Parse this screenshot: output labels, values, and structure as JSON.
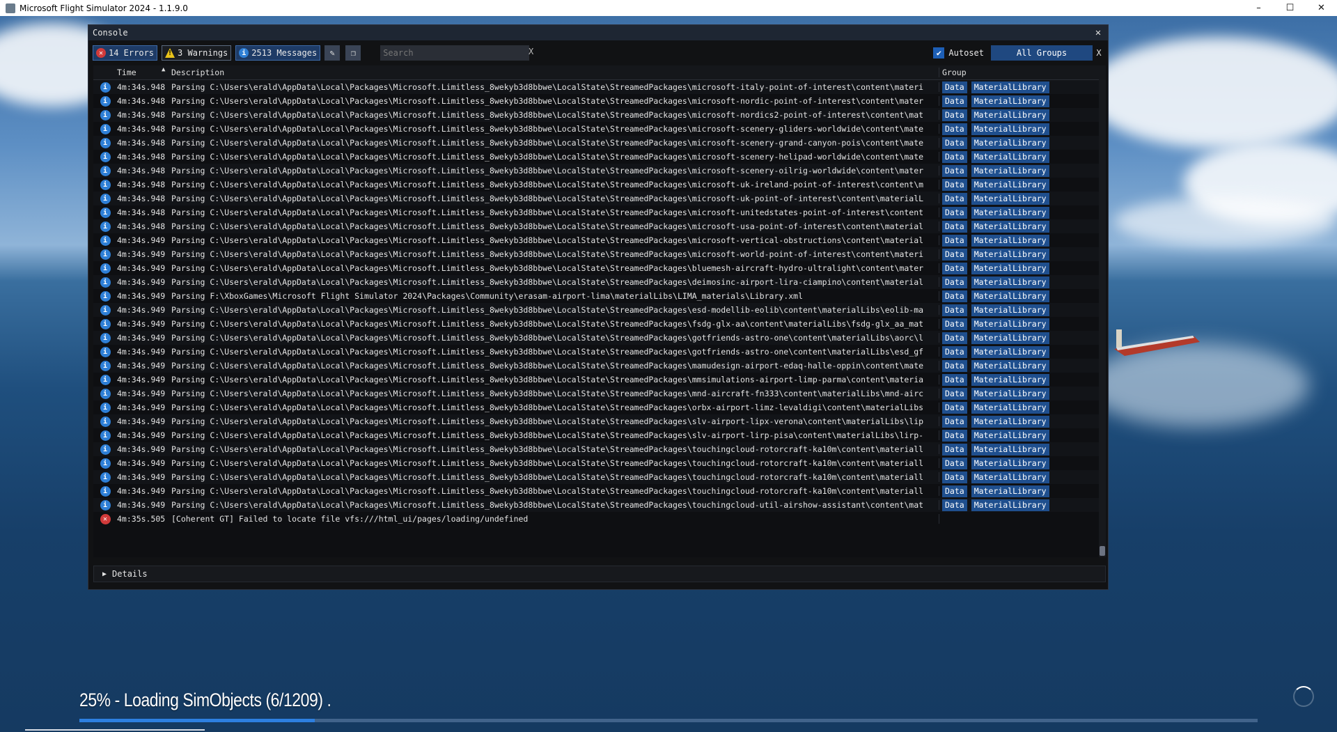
{
  "window": {
    "title": "Microsoft Flight Simulator 2024 - 1.1.9.0",
    "minimize": "–",
    "maximize": "☐",
    "close": "✕"
  },
  "console": {
    "title": "Console",
    "close": "✕",
    "filters": {
      "errors": "14 Errors",
      "warnings": "3 Warnings",
      "messages": "2513 Messages"
    },
    "search": {
      "placeholder": "Search",
      "clear": "X"
    },
    "autoset": "Autoset",
    "groups": "All Groups",
    "groups_clear": "X",
    "columns": {
      "time": "Time",
      "description": "Description",
      "group": "Group"
    },
    "rows": [
      {
        "type": "info",
        "time": "4m:34s.948",
        "desc": "Parsing C:\\Users\\erald\\AppData\\Local\\Packages\\Microsoft.Limitless_8wekyb3d8bbwe\\LocalState\\StreamedPackages\\microsoft-italy-point-of-interest\\content\\materi",
        "g1": "Data",
        "g2": "MaterialLibrary"
      },
      {
        "type": "info",
        "time": "4m:34s.948",
        "desc": "Parsing C:\\Users\\erald\\AppData\\Local\\Packages\\Microsoft.Limitless_8wekyb3d8bbwe\\LocalState\\StreamedPackages\\microsoft-nordic-point-of-interest\\content\\mater",
        "g1": "Data",
        "g2": "MaterialLibrary"
      },
      {
        "type": "info",
        "time": "4m:34s.948",
        "desc": "Parsing C:\\Users\\erald\\AppData\\Local\\Packages\\Microsoft.Limitless_8wekyb3d8bbwe\\LocalState\\StreamedPackages\\microsoft-nordics2-point-of-interest\\content\\mat",
        "g1": "Data",
        "g2": "MaterialLibrary"
      },
      {
        "type": "info",
        "time": "4m:34s.948",
        "desc": "Parsing C:\\Users\\erald\\AppData\\Local\\Packages\\Microsoft.Limitless_8wekyb3d8bbwe\\LocalState\\StreamedPackages\\microsoft-scenery-gliders-worldwide\\content\\mate",
        "g1": "Data",
        "g2": "MaterialLibrary"
      },
      {
        "type": "info",
        "time": "4m:34s.948",
        "desc": "Parsing C:\\Users\\erald\\AppData\\Local\\Packages\\Microsoft.Limitless_8wekyb3d8bbwe\\LocalState\\StreamedPackages\\microsoft-scenery-grand-canyon-pois\\content\\mate",
        "g1": "Data",
        "g2": "MaterialLibrary"
      },
      {
        "type": "info",
        "time": "4m:34s.948",
        "desc": "Parsing C:\\Users\\erald\\AppData\\Local\\Packages\\Microsoft.Limitless_8wekyb3d8bbwe\\LocalState\\StreamedPackages\\microsoft-scenery-helipad-worldwide\\content\\mate",
        "g1": "Data",
        "g2": "MaterialLibrary"
      },
      {
        "type": "info",
        "time": "4m:34s.948",
        "desc": "Parsing C:\\Users\\erald\\AppData\\Local\\Packages\\Microsoft.Limitless_8wekyb3d8bbwe\\LocalState\\StreamedPackages\\microsoft-scenery-oilrig-worldwide\\content\\mater",
        "g1": "Data",
        "g2": "MaterialLibrary"
      },
      {
        "type": "info",
        "time": "4m:34s.948",
        "desc": "Parsing C:\\Users\\erald\\AppData\\Local\\Packages\\Microsoft.Limitless_8wekyb3d8bbwe\\LocalState\\StreamedPackages\\microsoft-uk-ireland-point-of-interest\\content\\m",
        "g1": "Data",
        "g2": "MaterialLibrary"
      },
      {
        "type": "info",
        "time": "4m:34s.948",
        "desc": "Parsing C:\\Users\\erald\\AppData\\Local\\Packages\\Microsoft.Limitless_8wekyb3d8bbwe\\LocalState\\StreamedPackages\\microsoft-uk-point-of-interest\\content\\materialL",
        "g1": "Data",
        "g2": "MaterialLibrary"
      },
      {
        "type": "info",
        "time": "4m:34s.948",
        "desc": "Parsing C:\\Users\\erald\\AppData\\Local\\Packages\\Microsoft.Limitless_8wekyb3d8bbwe\\LocalState\\StreamedPackages\\microsoft-unitedstates-point-of-interest\\content",
        "g1": "Data",
        "g2": "MaterialLibrary"
      },
      {
        "type": "info",
        "time": "4m:34s.948",
        "desc": "Parsing C:\\Users\\erald\\AppData\\Local\\Packages\\Microsoft.Limitless_8wekyb3d8bbwe\\LocalState\\StreamedPackages\\microsoft-usa-point-of-interest\\content\\material",
        "g1": "Data",
        "g2": "MaterialLibrary"
      },
      {
        "type": "info",
        "time": "4m:34s.949",
        "desc": "Parsing C:\\Users\\erald\\AppData\\Local\\Packages\\Microsoft.Limitless_8wekyb3d8bbwe\\LocalState\\StreamedPackages\\microsoft-vertical-obstructions\\content\\material",
        "g1": "Data",
        "g2": "MaterialLibrary"
      },
      {
        "type": "info",
        "time": "4m:34s.949",
        "desc": "Parsing C:\\Users\\erald\\AppData\\Local\\Packages\\Microsoft.Limitless_8wekyb3d8bbwe\\LocalState\\StreamedPackages\\microsoft-world-point-of-interest\\content\\materi",
        "g1": "Data",
        "g2": "MaterialLibrary"
      },
      {
        "type": "info",
        "time": "4m:34s.949",
        "desc": "Parsing C:\\Users\\erald\\AppData\\Local\\Packages\\Microsoft.Limitless_8wekyb3d8bbwe\\LocalState\\StreamedPackages\\bluemesh-aircraft-hydro-ultralight\\content\\mater",
        "g1": "Data",
        "g2": "MaterialLibrary"
      },
      {
        "type": "info",
        "time": "4m:34s.949",
        "desc": "Parsing C:\\Users\\erald\\AppData\\Local\\Packages\\Microsoft.Limitless_8wekyb3d8bbwe\\LocalState\\StreamedPackages\\deimosinc-airport-lira-ciampino\\content\\material",
        "g1": "Data",
        "g2": "MaterialLibrary"
      },
      {
        "type": "info",
        "time": "4m:34s.949",
        "desc": "Parsing F:\\XboxGames\\Microsoft Flight Simulator 2024\\Packages\\Community\\erasam-airport-lima\\materialLibs\\LIMA_materials\\Library.xml",
        "g1": "Data",
        "g2": "MaterialLibrary"
      },
      {
        "type": "info",
        "time": "4m:34s.949",
        "desc": "Parsing C:\\Users\\erald\\AppData\\Local\\Packages\\Microsoft.Limitless_8wekyb3d8bbwe\\LocalState\\StreamedPackages\\esd-modellib-eolib\\content\\materialLibs\\eolib-ma",
        "g1": "Data",
        "g2": "MaterialLibrary"
      },
      {
        "type": "info",
        "time": "4m:34s.949",
        "desc": "Parsing C:\\Users\\erald\\AppData\\Local\\Packages\\Microsoft.Limitless_8wekyb3d8bbwe\\LocalState\\StreamedPackages\\fsdg-glx-aa\\content\\materialLibs\\fsdg-glx_aa_mat",
        "g1": "Data",
        "g2": "MaterialLibrary"
      },
      {
        "type": "info",
        "time": "4m:34s.949",
        "desc": "Parsing C:\\Users\\erald\\AppData\\Local\\Packages\\Microsoft.Limitless_8wekyb3d8bbwe\\LocalState\\StreamedPackages\\gotfriends-astro-one\\content\\materialLibs\\aorc\\l",
        "g1": "Data",
        "g2": "MaterialLibrary"
      },
      {
        "type": "info",
        "time": "4m:34s.949",
        "desc": "Parsing C:\\Users\\erald\\AppData\\Local\\Packages\\Microsoft.Limitless_8wekyb3d8bbwe\\LocalState\\StreamedPackages\\gotfriends-astro-one\\content\\materialLibs\\esd_gf",
        "g1": "Data",
        "g2": "MaterialLibrary"
      },
      {
        "type": "info",
        "time": "4m:34s.949",
        "desc": "Parsing C:\\Users\\erald\\AppData\\Local\\Packages\\Microsoft.Limitless_8wekyb3d8bbwe\\LocalState\\StreamedPackages\\mamudesign-airport-edaq-halle-oppin\\content\\mate",
        "g1": "Data",
        "g2": "MaterialLibrary"
      },
      {
        "type": "info",
        "time": "4m:34s.949",
        "desc": "Parsing C:\\Users\\erald\\AppData\\Local\\Packages\\Microsoft.Limitless_8wekyb3d8bbwe\\LocalState\\StreamedPackages\\mmsimulations-airport-limp-parma\\content\\materia",
        "g1": "Data",
        "g2": "MaterialLibrary"
      },
      {
        "type": "info",
        "time": "4m:34s.949",
        "desc": "Parsing C:\\Users\\erald\\AppData\\Local\\Packages\\Microsoft.Limitless_8wekyb3d8bbwe\\LocalState\\StreamedPackages\\mnd-aircraft-fn333\\content\\materialLibs\\mnd-airc",
        "g1": "Data",
        "g2": "MaterialLibrary"
      },
      {
        "type": "info",
        "time": "4m:34s.949",
        "desc": "Parsing C:\\Users\\erald\\AppData\\Local\\Packages\\Microsoft.Limitless_8wekyb3d8bbwe\\LocalState\\StreamedPackages\\orbx-airport-limz-levaldigi\\content\\materialLibs",
        "g1": "Data",
        "g2": "MaterialLibrary"
      },
      {
        "type": "info",
        "time": "4m:34s.949",
        "desc": "Parsing C:\\Users\\erald\\AppData\\Local\\Packages\\Microsoft.Limitless_8wekyb3d8bbwe\\LocalState\\StreamedPackages\\slv-airport-lipx-verona\\content\\materialLibs\\lip",
        "g1": "Data",
        "g2": "MaterialLibrary"
      },
      {
        "type": "info",
        "time": "4m:34s.949",
        "desc": "Parsing C:\\Users\\erald\\AppData\\Local\\Packages\\Microsoft.Limitless_8wekyb3d8bbwe\\LocalState\\StreamedPackages\\slv-airport-lirp-pisa\\content\\materialLibs\\lirp-",
        "g1": "Data",
        "g2": "MaterialLibrary"
      },
      {
        "type": "info",
        "time": "4m:34s.949",
        "desc": "Parsing C:\\Users\\erald\\AppData\\Local\\Packages\\Microsoft.Limitless_8wekyb3d8bbwe\\LocalState\\StreamedPackages\\touchingcloud-rotorcraft-ka10m\\content\\materiall",
        "g1": "Data",
        "g2": "MaterialLibrary"
      },
      {
        "type": "info",
        "time": "4m:34s.949",
        "desc": "Parsing C:\\Users\\erald\\AppData\\Local\\Packages\\Microsoft.Limitless_8wekyb3d8bbwe\\LocalState\\StreamedPackages\\touchingcloud-rotorcraft-ka10m\\content\\materiall",
        "g1": "Data",
        "g2": "MaterialLibrary"
      },
      {
        "type": "info",
        "time": "4m:34s.949",
        "desc": "Parsing C:\\Users\\erald\\AppData\\Local\\Packages\\Microsoft.Limitless_8wekyb3d8bbwe\\LocalState\\StreamedPackages\\touchingcloud-rotorcraft-ka10m\\content\\materiall",
        "g1": "Data",
        "g2": "MaterialLibrary"
      },
      {
        "type": "info",
        "time": "4m:34s.949",
        "desc": "Parsing C:\\Users\\erald\\AppData\\Local\\Packages\\Microsoft.Limitless_8wekyb3d8bbwe\\LocalState\\StreamedPackages\\touchingcloud-rotorcraft-ka10m\\content\\materiall",
        "g1": "Data",
        "g2": "MaterialLibrary"
      },
      {
        "type": "info",
        "time": "4m:34s.949",
        "desc": "Parsing C:\\Users\\erald\\AppData\\Local\\Packages\\Microsoft.Limitless_8wekyb3d8bbwe\\LocalState\\StreamedPackages\\touchingcloud-util-airshow-assistant\\content\\mat",
        "g1": "Data",
        "g2": "MaterialLibrary"
      },
      {
        "type": "error",
        "time": "4m:35s.505",
        "desc": "[Coherent GT] Failed to locate file vfs:///html_ui/pages/loading/undefined",
        "g1": "",
        "g2": ""
      }
    ],
    "details": "Details"
  },
  "loading": {
    "text": "25% - Loading SimObjects (6/1209) .",
    "progress": 0.25
  },
  "colors": {
    "accent": "#2d7fe0",
    "error": "#d13a3a",
    "info": "#2e7fd6",
    "warning": "#e8c21a"
  }
}
